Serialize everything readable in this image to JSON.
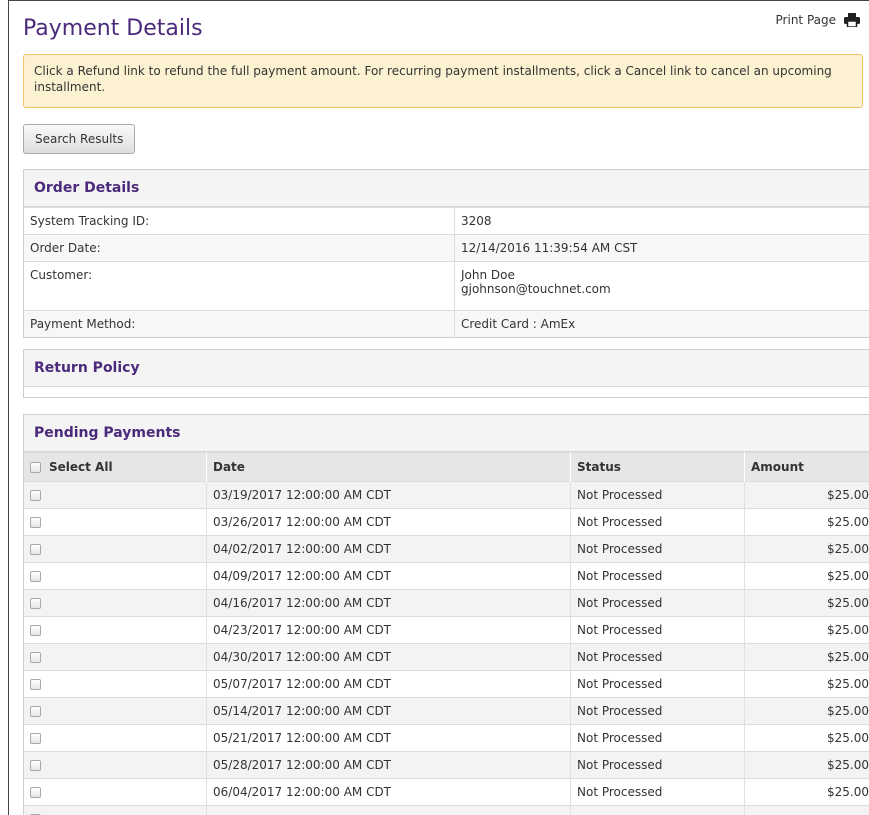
{
  "page": {
    "title": "Payment Details",
    "print_label": "Print Page"
  },
  "notice": "Click a Refund link to refund the full payment amount. For recurring payment installments, click a Cancel link to cancel an upcoming installment.",
  "buttons": {
    "search_results": "Search Results"
  },
  "order_details": {
    "heading": "Order Details",
    "rows": [
      {
        "label": "System Tracking ID:",
        "value": "3208"
      },
      {
        "label": "Order Date:",
        "value": "12/14/2016 11:39:54 AM CST"
      },
      {
        "label": "Customer:",
        "value": "John Doe",
        "value2": "gjohnson@touchnet.com"
      },
      {
        "label": "Payment Method:",
        "value": "Credit Card : AmEx"
      }
    ]
  },
  "return_policy": {
    "heading": "Return Policy"
  },
  "pending": {
    "heading": "Pending Payments",
    "columns": {
      "select_all": "Select All",
      "date": "Date",
      "status": "Status",
      "amount": "Amount"
    },
    "rows": [
      {
        "date": "03/19/2017 12:00:00 AM CDT",
        "status": "Not Processed",
        "amount": "$25.00"
      },
      {
        "date": "03/26/2017 12:00:00 AM CDT",
        "status": "Not Processed",
        "amount": "$25.00"
      },
      {
        "date": "04/02/2017 12:00:00 AM CDT",
        "status": "Not Processed",
        "amount": "$25.00"
      },
      {
        "date": "04/09/2017 12:00:00 AM CDT",
        "status": "Not Processed",
        "amount": "$25.00"
      },
      {
        "date": "04/16/2017 12:00:00 AM CDT",
        "status": "Not Processed",
        "amount": "$25.00"
      },
      {
        "date": "04/23/2017 12:00:00 AM CDT",
        "status": "Not Processed",
        "amount": "$25.00"
      },
      {
        "date": "04/30/2017 12:00:00 AM CDT",
        "status": "Not Processed",
        "amount": "$25.00"
      },
      {
        "date": "05/07/2017 12:00:00 AM CDT",
        "status": "Not Processed",
        "amount": "$25.00"
      },
      {
        "date": "05/14/2017 12:00:00 AM CDT",
        "status": "Not Processed",
        "amount": "$25.00"
      },
      {
        "date": "05/21/2017 12:00:00 AM CDT",
        "status": "Not Processed",
        "amount": "$25.00"
      },
      {
        "date": "05/28/2017 12:00:00 AM CDT",
        "status": "Not Processed",
        "amount": "$25.00"
      },
      {
        "date": "06/04/2017 12:00:00 AM CDT",
        "status": "Not Processed",
        "amount": "$25.00"
      },
      {
        "date": "",
        "status": "",
        "amount": ""
      }
    ]
  }
}
